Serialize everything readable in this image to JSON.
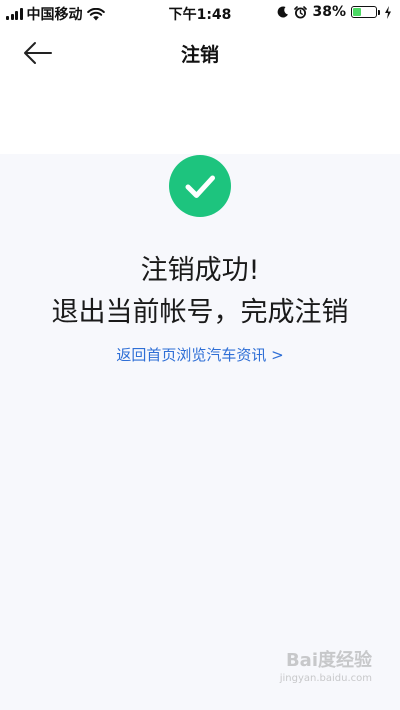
{
  "status_bar": {
    "carrier": "中国移动",
    "time": "下午1:48",
    "battery_percent": "38%",
    "battery_level": 0.38,
    "icons": [
      "signal-icon",
      "wifi-icon",
      "moon-icon",
      "alarm-icon",
      "battery-icon",
      "charging-icon"
    ]
  },
  "nav": {
    "title": "注销",
    "back_icon": "back-arrow-icon"
  },
  "result": {
    "icon": "check-circle-icon",
    "line1": "注销成功!",
    "line2": "退出当前帐号，完成注销",
    "link": "返回首页浏览汽车资讯 >"
  },
  "watermark": {
    "brand": "Bai度经验",
    "url": "jingyan.baidu.com"
  },
  "colors": {
    "success": "#1dc47e",
    "link": "#2f6fd6",
    "background": "#f7f8fc"
  }
}
